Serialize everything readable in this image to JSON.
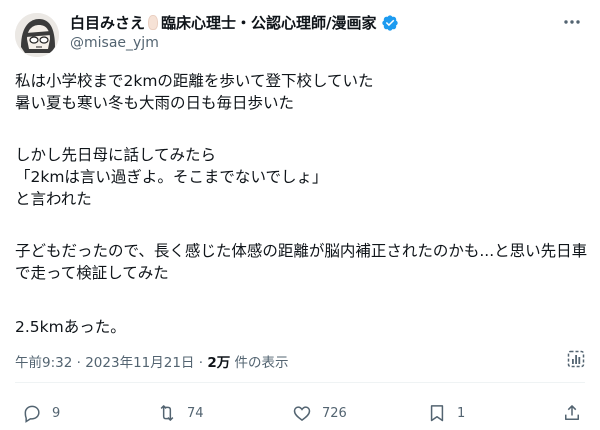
{
  "author": {
    "display_name": "白目みさえ",
    "title_suffix": "臨床心理士・公認心理師/漫画家",
    "handle": "@misae_yjm"
  },
  "tweet": {
    "paragraphs": [
      "私は小学校まで2kmの距離を歩いて登下校していた\n暑い夏も寒い冬も大雨の日も毎日歩いた",
      "しかし先日母に話してみたら\n「2kmは言い過ぎよ。そこまでないでしょ」\nと言われた",
      "子どもだったので、長く感じた体感の距離が脳内補正されたのかも...と思い先日車で走って検証してみた",
      "2.5kmあった。"
    ]
  },
  "meta": {
    "time": "午前9:32",
    "separator": "·",
    "date": "2023年11月21日",
    "views_count": "2万",
    "views_label": " 件の表示"
  },
  "actions": {
    "replies": "9",
    "reposts": "74",
    "likes": "726",
    "bookmarks": "1"
  },
  "colors": {
    "text": "#0f1419",
    "secondary": "#536471",
    "verified": "#1d9bf0"
  },
  "icons": [
    "more-icon",
    "verified-icon",
    "analytics-icon",
    "reply-icon",
    "repost-icon",
    "like-icon",
    "bookmark-icon",
    "share-icon"
  ]
}
